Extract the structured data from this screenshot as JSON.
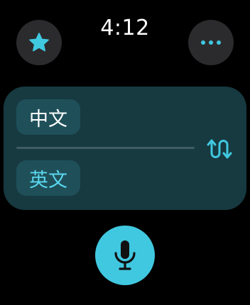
{
  "status": {
    "time": "4:12"
  },
  "header": {
    "favorite_icon": "star-icon",
    "more_icon": "ellipsis-icon"
  },
  "languages": {
    "source": "中文",
    "target": "英文",
    "swap_icon": "swap-arrows-icon"
  },
  "mic": {
    "icon": "microphone-icon"
  },
  "colors": {
    "accent": "#40c8e0",
    "card_bg": "#173940",
    "chip_bg": "#1f505a",
    "target_text": "#5ad7ee"
  }
}
